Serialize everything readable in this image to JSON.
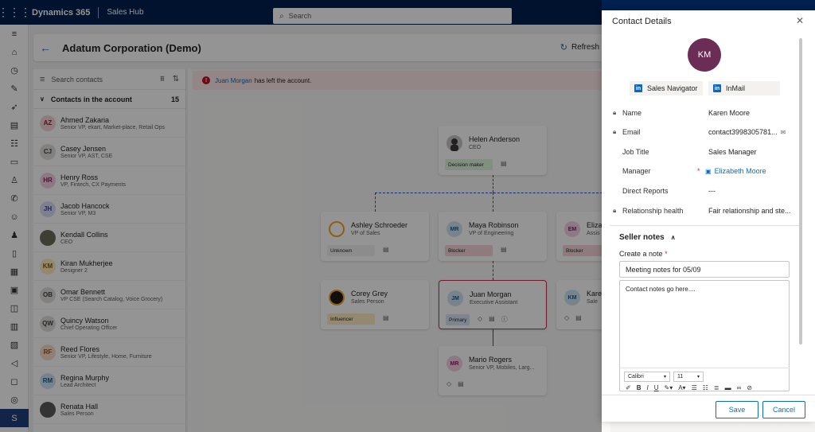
{
  "topbar": {
    "brand": "Dynamics 365",
    "app_name": "Sales Hub",
    "search_placeholder": "Search"
  },
  "header": {
    "title": "Adatum Corporation (Demo)",
    "refresh_label": "Refresh"
  },
  "list": {
    "search_placeholder": "Search contacts",
    "group_label": "Contacts in the account",
    "group_count": "15",
    "contacts": [
      {
        "initials": "AZ",
        "name": "Ahmed Zakaria",
        "title": "Senior VP, ekart, Market-place, Retail Ops",
        "color": "#f6d4d8",
        "fg": "#8a2433"
      },
      {
        "initials": "CJ",
        "name": "Casey Jensen",
        "title": "Senior VP, AST, CSE",
        "color": "#e1dfdd",
        "fg": "#424242"
      },
      {
        "initials": "HR",
        "name": "Henry Ross",
        "title": "VP, Fintech, CX Payments",
        "color": "#f3d1e4",
        "fg": "#8c1d5c"
      },
      {
        "initials": "JH",
        "name": "Jacob Hancock",
        "title": "Senior VP, M3",
        "color": "#dbdcf7",
        "fg": "#3a3d9c"
      },
      {
        "initials": "",
        "name": "Kendall Collins",
        "title": "CEO",
        "color": "#6b6b5a",
        "fg": "#ffffff"
      },
      {
        "initials": "KM",
        "name": "Kiran Mukherjee",
        "title": "Designer 2",
        "color": "#fcecc2",
        "fg": "#7a5a00"
      },
      {
        "initials": "OB",
        "name": "Omar Bennett",
        "title": "VP CSE (Search Catalog, Voice Grocery)",
        "color": "#e1dfdd",
        "fg": "#424242"
      },
      {
        "initials": "QW",
        "name": "Quincy Watson",
        "title": "Chief Operating Officer",
        "color": "#e1dfdd",
        "fg": "#424242"
      },
      {
        "initials": "RF",
        "name": "Reed Flores",
        "title": "Senior VP, Lifestyle, Home, Furniture",
        "color": "#f9dcc9",
        "fg": "#9a4a1a"
      },
      {
        "initials": "RM",
        "name": "Regina Murphy",
        "title": "Lead Architect",
        "color": "#cfe4f2",
        "fg": "#1a5a8a"
      },
      {
        "initials": "",
        "name": "Renata Hall",
        "title": "Sales Person",
        "color": "#5a5a5a",
        "fg": "#ffffff"
      }
    ]
  },
  "banner": {
    "person": "Juan Morgan",
    "message": "has left the account."
  },
  "org": {
    "helen": {
      "name": "Helen Anderson",
      "title": "CEO",
      "tag": "Decision maker"
    },
    "ashley": {
      "name": "Ashley Schroeder",
      "title": "VP of Sales",
      "tag": "Unknown"
    },
    "maya": {
      "initials": "MR",
      "name": "Maya Robinson",
      "title": "VP of Engineering",
      "tag": "Blocker"
    },
    "eliza": {
      "initials": "EM",
      "name": "Eliza",
      "title": "Assis",
      "tag": "Blocker"
    },
    "corey": {
      "name": "Corey Grey",
      "title": "Sales Person",
      "tag": "Influencer"
    },
    "juan": {
      "initials": "JM",
      "name": "Juan Morgan",
      "title": "Executive Assistant",
      "tag": "Primary"
    },
    "karen": {
      "initials": "KM",
      "name": "Kare",
      "title": "Sale"
    },
    "mario": {
      "initials": "MR",
      "name": "Mario Rogers",
      "title": "Senior VP, Mobiles, Larg..."
    }
  },
  "panel": {
    "title": "Contact Details",
    "avatar_initials": "KM",
    "sales_navigator": "Sales Navigator",
    "inmail": "InMail",
    "fields": {
      "name_label": "Name",
      "name_value": "Karen Moore",
      "email_label": "Email",
      "email_value": "contact3998305781...",
      "job_label": "Job Title",
      "job_value": "Sales Manager",
      "manager_label": "Manager",
      "manager_value": "Elizabeth Moore",
      "reports_label": "Direct Reports",
      "reports_value": "---",
      "health_label": "Relationship health",
      "health_value": "Fair relationship and ste..."
    },
    "seller_notes": "Seller notes",
    "create_note_label": "Create a note",
    "note_title_value": "Meeting notes for 05/09",
    "note_body": "Contact notes go here....",
    "font_name": "Calibri",
    "font_size": "11",
    "save": "Save",
    "cancel": "Cancel"
  }
}
